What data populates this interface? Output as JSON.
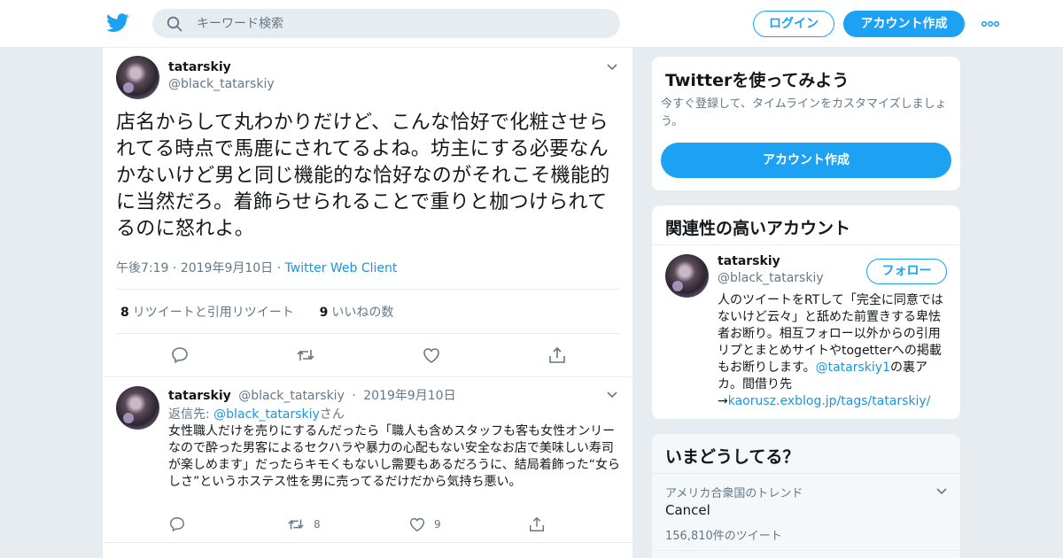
{
  "header": {
    "search_placeholder": "キーワード検索",
    "login_label": "ログイン",
    "signup_label": "アカウント作成",
    "brand_color": "#1da1f2"
  },
  "main_tweet": {
    "name": "tatarskiy",
    "handle": "@black_tatarskiy",
    "text": "店名からして丸わかりだけど、こんな恰好で化粧させられてる時点で馬鹿にされてるよね。坊主にする必要なんかないけど男と同じ機能的な恰好なのがそれこそ機能的に当然だろ。着飾らせられることで重りと枷つけられてるのに怒れよ。",
    "time": "午後7:19",
    "date": "2019年9月10日",
    "client": "Twitter Web Client",
    "retweet_count": "8",
    "retweet_label": "リツイートと引用リツイート",
    "like_count": "9",
    "like_label": "いいねの数",
    "icons": [
      "reply-icon",
      "retweet-icon",
      "like-icon",
      "share-icon"
    ]
  },
  "reply_tweet": {
    "name": "tatarskiy",
    "handle": "@black_tatarskiy",
    "date": "2019年9月10日",
    "reply_to_prefix": "返信先:",
    "reply_to_handle": "@black_tatarskiy",
    "reply_to_suffix": "さん",
    "text": "女性職人だけを売りにするんだったら「職人も含めスタッフも客も女性オンリーなので酔った男客によるセクハラや暴力の心配もない安全なお店で美味しい寿司が楽しめます」だったらキモくもないし需要もあるだろうに、結局着飾った“女らしさ”というホステス性を男に売ってるだけだから気持ち悪い。",
    "retweet_count": "8",
    "like_count": "9"
  },
  "signup_card": {
    "title": "Twitterを使ってみよう",
    "description": "今すぐ登録して、タイムラインをカスタマイズしましょう。",
    "button_label": "アカウント作成"
  },
  "related_card": {
    "title": "関連性の高いアカウント",
    "name": "tatarskiy",
    "handle": "@black_tatarskiy",
    "follow_label": "フォロー",
    "bio_part1": "人のツイートをRTして「完全に同意ではないけど云々」と舐めた前置きする卑怯者お断り。相互フォロー以外からの引用リプとまとめサイトやtogetterへの掲載もお断りします。",
    "bio_mention": "@tatarskiy1",
    "bio_part2": "の裏アカ。間借り先→",
    "bio_link": "kaorusz.exblog.jp/tags/tatarskiy/"
  },
  "trends_card": {
    "title": "いまどうしてる？",
    "location": "アメリカ合衆国のトレンド",
    "trend_name": "Cancel",
    "trend_count": "156,810件のツイート"
  }
}
